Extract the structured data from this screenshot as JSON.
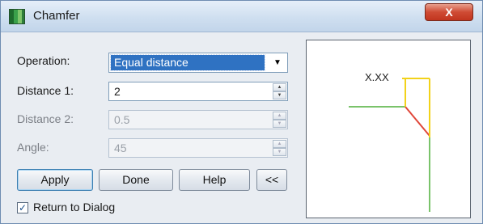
{
  "window": {
    "title": "Chamfer",
    "close_label": "X"
  },
  "form": {
    "operation": {
      "label": "Operation:",
      "value": "Equal distance"
    },
    "distance1": {
      "label": "Distance 1:",
      "value": "2"
    },
    "distance2": {
      "label": "Distance 2:",
      "value": "0.5"
    },
    "angle": {
      "label": "Angle:",
      "value": "45"
    }
  },
  "buttons": {
    "apply": "Apply",
    "done": "Done",
    "help": "Help",
    "collapse": "<<"
  },
  "return_to_dialog": {
    "label": "Return to Dialog",
    "checked": true
  },
  "preview": {
    "dimension_label": "X.XX",
    "colors": {
      "yellow": "#f2d21a",
      "green": "#7ac36a",
      "red": "#e0473a",
      "gray": "#9a9a9a"
    }
  }
}
